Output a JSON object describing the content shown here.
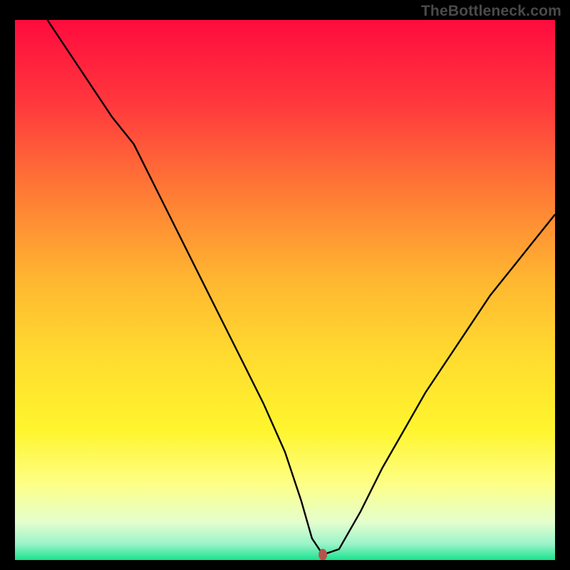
{
  "watermark": "TheBottleneck.com",
  "chart_data": {
    "type": "line",
    "title": "",
    "xlabel": "",
    "ylabel": "",
    "xlim": [
      0,
      100
    ],
    "ylim": [
      0,
      100
    ],
    "grid": false,
    "legend": false,
    "background_gradient": {
      "stops": [
        {
          "pos": 0.0,
          "color": "#ff0b3e"
        },
        {
          "pos": 0.16,
          "color": "#ff3a3d"
        },
        {
          "pos": 0.32,
          "color": "#ff7b35"
        },
        {
          "pos": 0.48,
          "color": "#ffb631"
        },
        {
          "pos": 0.62,
          "color": "#ffdb2f"
        },
        {
          "pos": 0.76,
          "color": "#fff52e"
        },
        {
          "pos": 0.86,
          "color": "#fdff87"
        },
        {
          "pos": 0.93,
          "color": "#e3ffce"
        },
        {
          "pos": 0.97,
          "color": "#9cf3c9"
        },
        {
          "pos": 1.0,
          "color": "#19e38e"
        }
      ]
    },
    "marker": {
      "x": 57.0,
      "y": 1.0,
      "color": "#b6524b"
    },
    "series": [
      {
        "name": "bottleneck_curve",
        "x": [
          6,
          10,
          14,
          18,
          22,
          26,
          30,
          34,
          38,
          42,
          46,
          50,
          53,
          55,
          57,
          60,
          64,
          68,
          72,
          76,
          80,
          84,
          88,
          92,
          96,
          100
        ],
        "y": [
          100,
          94,
          88,
          82,
          77,
          69,
          61,
          53,
          45,
          37,
          29,
          20,
          11,
          4,
          1,
          2,
          9,
          17,
          24,
          31,
          37,
          43,
          49,
          54,
          59,
          64
        ]
      }
    ]
  }
}
